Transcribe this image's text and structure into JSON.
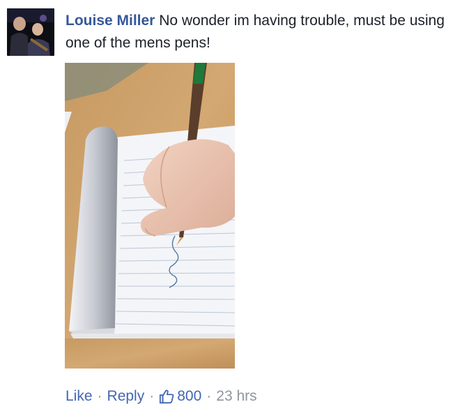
{
  "comment": {
    "author": "Louise Miller",
    "text": "No wonder im having trouble, must be using one of the mens pens!",
    "actions": {
      "like": "Like",
      "separator": "·",
      "reply": "Reply",
      "like_count": "800",
      "timestamp": "23 hrs"
    },
    "icons": {
      "like": "thumbs-up-icon"
    },
    "colors": {
      "author": "#365899",
      "link": "#4267b2",
      "meta": "#90949c",
      "text": "#1d2129"
    }
  }
}
